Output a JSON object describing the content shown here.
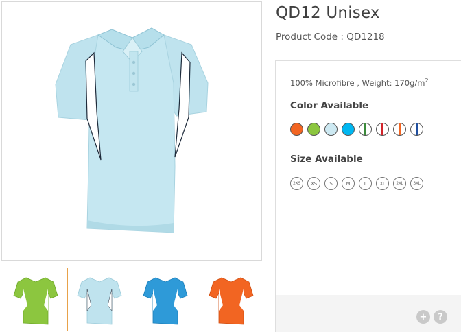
{
  "product": {
    "title": "QD12 Unisex",
    "code_label": "Product Code : QD1218",
    "spec_text": "100% Microfibre , Weight: 170g/m",
    "spec_sup": "2"
  },
  "colors_section": {
    "title": "Color Available",
    "swatches": [
      {
        "name": "orange",
        "fill": "#f26522",
        "stripe": ""
      },
      {
        "name": "lime",
        "fill": "#8cc63f",
        "stripe": ""
      },
      {
        "name": "light-blue",
        "fill": "#cde9f2",
        "stripe": ""
      },
      {
        "name": "sky-blue",
        "fill": "#00b7f1",
        "stripe": ""
      },
      {
        "name": "white-green",
        "fill": "#ffffff",
        "stripe": "#3a8a3a"
      },
      {
        "name": "white-red",
        "fill": "#ffffff",
        "stripe": "#d2232a"
      },
      {
        "name": "white-orange",
        "fill": "#ffffff",
        "stripe": "#f26522"
      },
      {
        "name": "white-navy",
        "fill": "#ffffff",
        "stripe": "#1f4e9e"
      }
    ]
  },
  "sizes_section": {
    "title": "Size Available",
    "sizes": [
      "2XS",
      "XS",
      "S",
      "M",
      "L",
      "XL",
      "2XL",
      "3XL"
    ]
  },
  "thumbnails": [
    {
      "name": "lime",
      "color": "#8cc63f",
      "selected": false
    },
    {
      "name": "light-blue",
      "color": "#bfe3ee",
      "selected": true
    },
    {
      "name": "blue",
      "color": "#2e9ad8",
      "selected": false
    },
    {
      "name": "orange",
      "color": "#f26522",
      "selected": false
    }
  ],
  "actions": {
    "zoom_label": "+",
    "help_label": "?"
  }
}
